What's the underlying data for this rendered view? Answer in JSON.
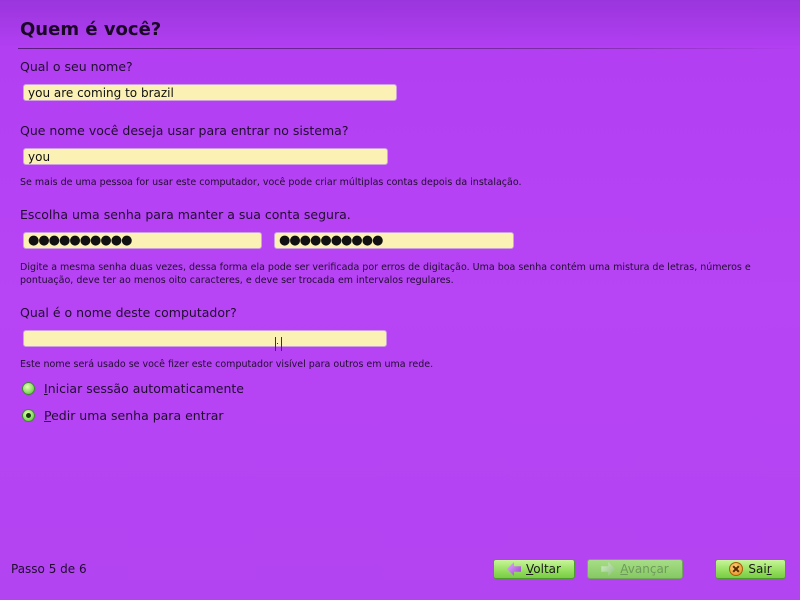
{
  "page": {
    "title": "Quem é você?"
  },
  "name_section": {
    "label": "Qual o seu nome?",
    "value": "you are coming to brazil"
  },
  "username_section": {
    "label": "Que nome você deseja usar para entrar no sistema?",
    "value": "you",
    "help": "Se mais de uma pessoa for usar este computador, você pode criar múltiplas contas depois da instalação."
  },
  "password_section": {
    "label": "Escolha uma senha para manter a sua conta segura.",
    "password_dots": "●●●●●●●●●●",
    "confirm_dots": "●●●●●●●●●●",
    "help": "Digite a mesma senha duas vezes, dessa forma ela pode ser verificada por erros de digitação. Uma boa senha contém uma mistura de letras, números e pontuação, deve ter ao menos oito caracteres, e deve ser trocada em intervalos regulares."
  },
  "hostname_section": {
    "label": "Qual é o nome deste computador?",
    "value": "",
    "help": "Este nome será usado se você fizer este computador visível para outros em uma rede."
  },
  "login_options": [
    {
      "first_letter": "I",
      "rest": "niciar sessão automaticamente",
      "checked": false
    },
    {
      "first_letter": "P",
      "rest": "edir uma senha para entrar",
      "checked": true
    }
  ],
  "footer": {
    "step_text": "Passo 5 de 6",
    "back_first": "V",
    "back_rest": "oltar",
    "forward_first": "A",
    "forward_rest": "vançar",
    "quit_first": "Sai",
    "quit_rest": "r"
  }
}
